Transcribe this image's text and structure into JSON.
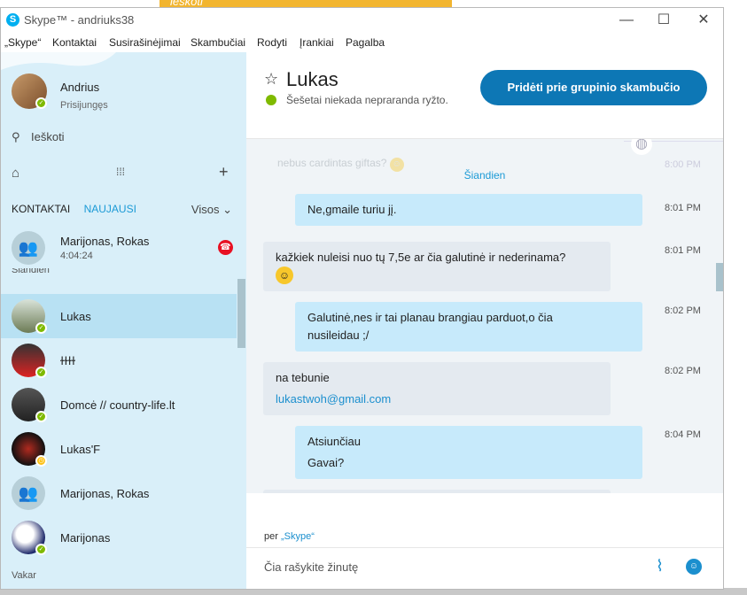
{
  "background": {
    "strip_text": "ieškoti",
    "strip_btn": "Forumas"
  },
  "window": {
    "title": "Skype™ - andriuks38",
    "logo": "S"
  },
  "menu": [
    "„Skype“",
    "Kontaktai",
    "Susirašinėjimai",
    "Skambučiai",
    "Rodyti",
    "Įrankiai",
    "Pagalba"
  ],
  "profile": {
    "name": "Andrius",
    "status": "Prisijungęs"
  },
  "search": {
    "label": "Ieškoti"
  },
  "tabs": {
    "contacts": "KONTAKTAI",
    "recent": "NAUJAUSI",
    "filter": "Visos"
  },
  "contacts": [
    {
      "name": "Marijonas, Rokas",
      "time": "4:04:24"
    },
    {
      "name": "Lukas"
    },
    {
      "name": "ɫɫɫɫ"
    },
    {
      "name": "Domcė // country-life.lt"
    },
    {
      "name": "Lukas'F"
    },
    {
      "name": "Marijonas, Rokas"
    },
    {
      "name": "Marijonas"
    }
  ],
  "sections": {
    "today_fragment": "Šiandien",
    "yesterday": "Vakar"
  },
  "chat": {
    "name": "Lukas",
    "mood": "Šešetai niekada nepraranda ryžto.",
    "call_button": "Pridėti prie grupinio skambučio",
    "faded_msg": "nebus cardintas giftas?",
    "faded_time": "8:00 PM",
    "date_sep": "Šiandien",
    "messages": [
      {
        "dir": "out",
        "lines": [
          "Ne,gmaile turiu jį."
        ],
        "time": "8:01 PM"
      },
      {
        "dir": "in",
        "lines": [
          "kažkiek nuleisi nuo tų 7,5e ar čia galutinė ir nederinama?"
        ],
        "emoji": "smile",
        "time": "8:01 PM"
      },
      {
        "dir": "out",
        "lines": [
          "Galutinė,nes ir tai planau brangiau parduot,o čia",
          "nusileidau ;/"
        ],
        "time": "8:02 PM"
      },
      {
        "dir": "in",
        "lines": [
          "na tebunie"
        ],
        "link": "lukastwoh@gmail.com",
        "time": "8:02 PM"
      },
      {
        "dir": "out",
        "lines": [
          "Atsiunčiau",
          "Gavai?"
        ],
        "time": "8:04 PM"
      }
    ],
    "via_prefix": "per ",
    "via_app": "„Skype“",
    "composer_placeholder": "Čia rašykite žinutę"
  }
}
